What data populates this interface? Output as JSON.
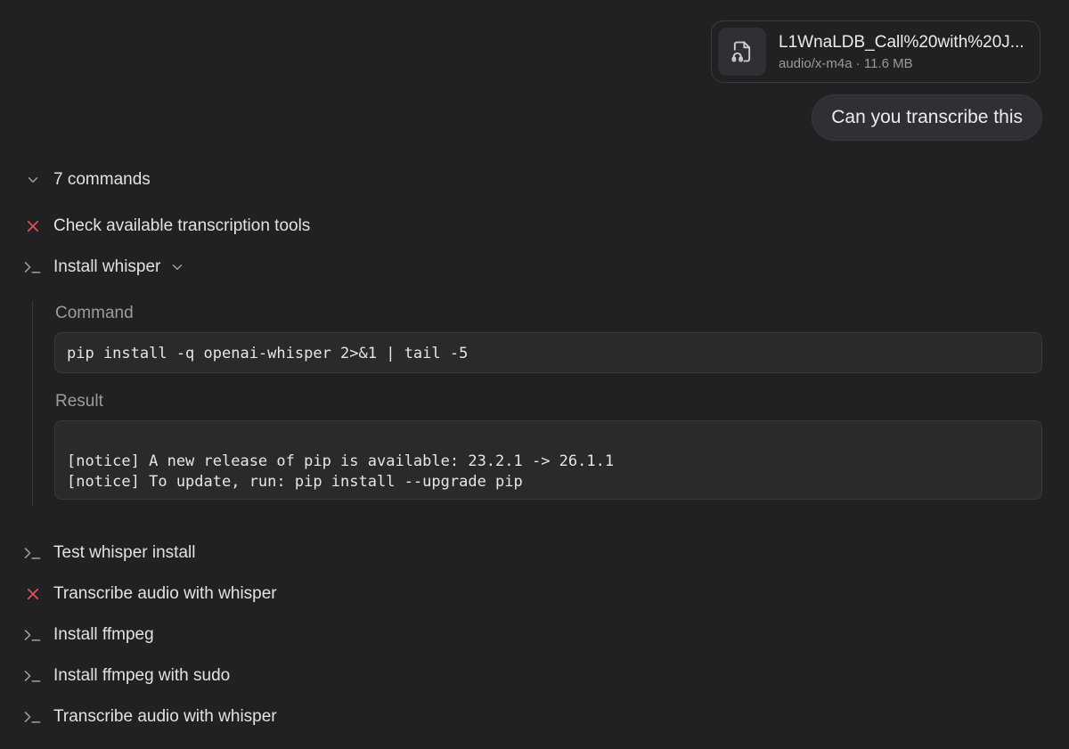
{
  "attachment": {
    "file_name": "L1WnaLDB_Call%20with%20J...",
    "file_type": "audio/x-m4a",
    "separator": " · ",
    "file_size": "11.6 MB",
    "icon": "audio-file-icon"
  },
  "message": {
    "text": "Can you transcribe this"
  },
  "commands": {
    "summary": "7 commands",
    "items": [
      {
        "label": "Check available transcription tools",
        "status": "failed",
        "icon": "x-icon"
      },
      {
        "label": "Install whisper",
        "status": "expanded",
        "icon": "terminal-icon"
      },
      {
        "label": "Test whisper install",
        "status": "ok",
        "icon": "terminal-icon"
      },
      {
        "label": "Transcribe audio with whisper",
        "status": "failed",
        "icon": "x-icon"
      },
      {
        "label": "Install ffmpeg",
        "status": "ok",
        "icon": "terminal-icon"
      },
      {
        "label": "Install ffmpeg with sudo",
        "status": "ok",
        "icon": "terminal-icon"
      },
      {
        "label": "Transcribe audio with whisper",
        "status": "ok",
        "icon": "terminal-icon"
      }
    ],
    "detail": {
      "command_label": "Command",
      "command": "pip install -q openai-whisper 2>&1 | tail -5",
      "result_label": "Result",
      "result_lines": [
        "[notice] A new release of pip is available: 23.2.1 -> 26.1.1",
        "[notice] To update, run: pip install --upgrade pip"
      ]
    }
  },
  "colors": {
    "background": "#212124",
    "error": "#e5535a",
    "muted": "#9c9c9f"
  }
}
